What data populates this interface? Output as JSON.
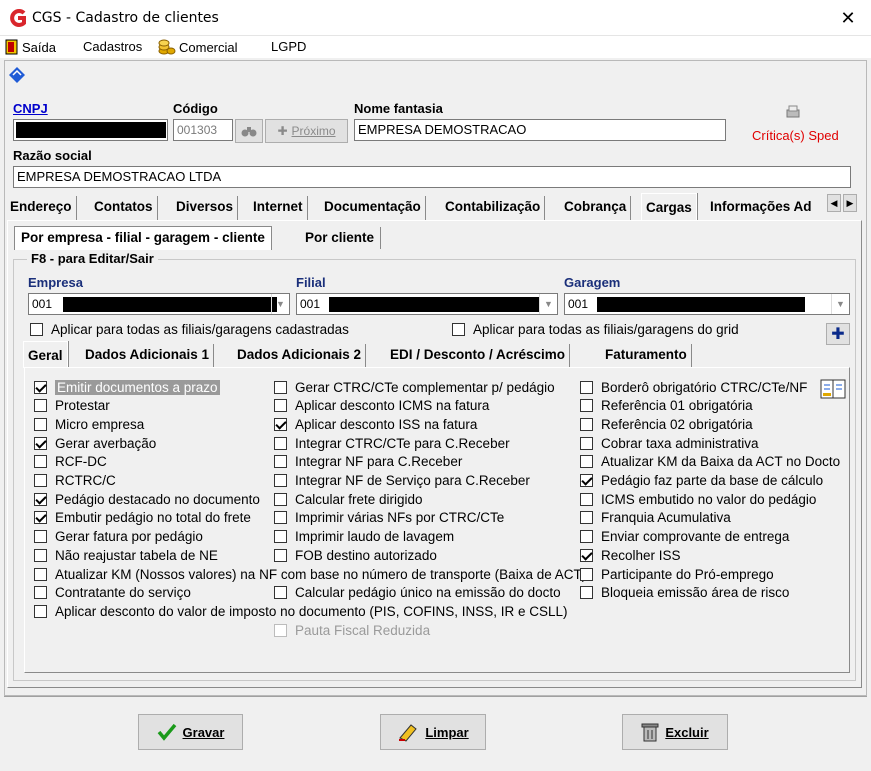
{
  "window": {
    "title": "CGS - Cadastro de clientes",
    "close": "✕"
  },
  "menu": {
    "items": [
      {
        "label": "Saída",
        "icon": "exit-icon"
      },
      {
        "label": "Cadastros",
        "icon": ""
      },
      {
        "label": "Comercial",
        "icon": "coins-icon"
      },
      {
        "label": "LGPD",
        "icon": ""
      }
    ]
  },
  "header": {
    "cnpj_label": "CNPJ",
    "codigo_label": "Código",
    "codigo_value": "001303",
    "proximo_label": "Próximo",
    "nome_fantasia_label": "Nome fantasia",
    "nome_fantasia_value": "EMPRESA DEMOSTRACAO",
    "critica_label": "Crítica(s) Sped",
    "razao_social_label": "Razão social",
    "razao_social_value": "EMPRESA DEMOSTRACAO LTDA"
  },
  "tabs": [
    "Endereço",
    "Contatos",
    "Diversos",
    "Internet",
    "Documentação",
    "Contabilização",
    "Cobrança",
    "Cargas",
    "Informações Ad"
  ],
  "active_tab": "Cargas",
  "subtabs": [
    "Por empresa - filial - garagem - cliente",
    "Por cliente"
  ],
  "group": {
    "title": "F8 - para Editar/Sair",
    "empresa_label": "Empresa",
    "empresa_value": "001",
    "filial_label": "Filial",
    "filial_value": "001",
    "garagem_label": "Garagem",
    "garagem_value": "001",
    "apply_all_label": "Aplicar para todas as filiais/garagens cadastradas",
    "apply_grid_label": "Aplicar para todas as filiais/garagens do grid"
  },
  "inner_tabs": [
    "Geral",
    "Dados Adicionais 1",
    "Dados Adicionais 2",
    "EDI / Desconto / Acréscimo",
    "Faturamento"
  ],
  "checkboxes": {
    "col1": [
      {
        "label": "Emitir documentos a prazo",
        "checked": true,
        "highlight": true
      },
      {
        "label": "Protestar",
        "checked": false
      },
      {
        "label": "Micro empresa",
        "checked": false
      },
      {
        "label": "Gerar averbação",
        "checked": true
      },
      {
        "label": "RCF-DC",
        "checked": false
      },
      {
        "label": "RCTRC/C",
        "checked": false
      },
      {
        "label": "Pedágio destacado no documento",
        "checked": true
      },
      {
        "label": "Embutir pedágio no total do frete",
        "checked": true
      },
      {
        "label": "Gerar fatura por pedágio",
        "checked": false
      },
      {
        "label": "Não reajustar tabela de NE",
        "checked": false
      },
      {
        "label": "Atualizar KM (Nossos valores) na NF com base no número de transporte (Baixa de ACT)",
        "checked": false
      },
      {
        "label": "Contratante do serviço",
        "checked": false
      },
      {
        "label": "Aplicar desconto do valor de imposto no documento (PIS, COFINS, INSS, IR e CSLL)",
        "checked": false
      }
    ],
    "col2": [
      {
        "label": "Gerar CTRC/CTe complementar p/ pedágio",
        "checked": false
      },
      {
        "label": "Aplicar desconto ICMS na fatura",
        "checked": false
      },
      {
        "label": "Aplicar desconto ISS na fatura",
        "checked": true
      },
      {
        "label": "Integrar CTRC/CTe para C.Receber",
        "checked": false
      },
      {
        "label": "Integrar NF para C.Receber",
        "checked": false
      },
      {
        "label": "Integrar NF de Serviço para C.Receber",
        "checked": false
      },
      {
        "label": "Calcular frete dirigido",
        "checked": false
      },
      {
        "label": "Imprimir várias NFs por CTRC/CTe",
        "checked": false
      },
      {
        "label": "Imprimir laudo de lavagem",
        "checked": false
      },
      {
        "label": "FOB destino autorizado",
        "checked": false
      },
      {
        "label": "Calcular pedágio único na emissão do docto",
        "checked": false
      },
      {
        "label": "Pauta Fiscal Reduzida",
        "checked": false,
        "disabled": true
      }
    ],
    "col3": [
      {
        "label": "Borderô obrigatório  CTRC/CTe/NF",
        "checked": false
      },
      {
        "label": "Referência 01 obrigatória",
        "checked": false
      },
      {
        "label": "Referência 02 obrigatória",
        "checked": false
      },
      {
        "label": "Cobrar taxa administrativa",
        "checked": false
      },
      {
        "label": "Atualizar KM da Baixa da ACT no Docto",
        "checked": false
      },
      {
        "label": "Pedágio faz parte da base de cálculo",
        "checked": true
      },
      {
        "label": "ICMS embutido no valor do pedágio",
        "checked": false
      },
      {
        "label": "Franquia Acumulativa",
        "checked": false
      },
      {
        "label": "Enviar comprovante de entrega",
        "checked": false
      },
      {
        "label": "Recolher ISS",
        "checked": true
      },
      {
        "label": "Participante do Pró-emprego",
        "checked": false
      },
      {
        "label": "Bloqueia emissão área de risco",
        "checked": false
      }
    ]
  },
  "footer": {
    "gravar": "Gravar",
    "limpar": "Limpar",
    "excluir": "Excluir"
  }
}
